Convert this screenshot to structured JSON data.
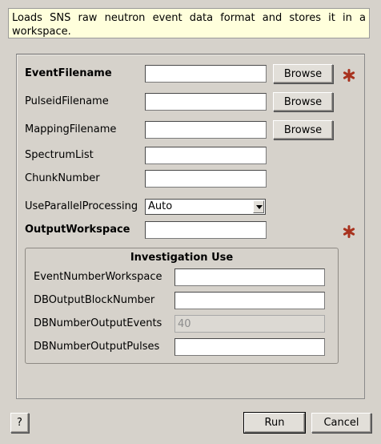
{
  "description": "Loads SNS raw neutron event data format and stores it in a workspace.",
  "fields": {
    "event_filename": {
      "label": "EventFilename",
      "value": "",
      "button": "Browse",
      "required": true
    },
    "pulseid_filename": {
      "label": "PulseidFilename",
      "value": "",
      "button": "Browse"
    },
    "mapping_filename": {
      "label": "MappingFilename",
      "value": "",
      "button": "Browse"
    },
    "spectrum_list": {
      "label": "SpectrumList",
      "value": ""
    },
    "chunk_number": {
      "label": "ChunkNumber",
      "value": ""
    },
    "use_parallel": {
      "label": "UseParallelProcessing",
      "selected": "Auto"
    },
    "output_workspace": {
      "label": "OutputWorkspace",
      "value": "",
      "required": true
    }
  },
  "investigation": {
    "title": "Investigation Use",
    "event_number_workspace": {
      "label": "EventNumberWorkspace",
      "value": ""
    },
    "db_output_block_number": {
      "label": "DBOutputBlockNumber",
      "value": ""
    },
    "db_number_output_events": {
      "label": "DBNumberOutputEvents",
      "value": "40"
    },
    "db_number_output_pulses": {
      "label": "DBNumberOutputPulses",
      "value": ""
    }
  },
  "footer": {
    "help_label": "?",
    "run_label": "Run",
    "cancel_label": "Cancel"
  },
  "colors": {
    "required_star": "#a8321e",
    "description_bg": "#ffffdc",
    "window_bg": "#d6d2cb"
  },
  "icons": {
    "required": "asterisk-icon",
    "dropdown": "chevron-down-icon"
  }
}
